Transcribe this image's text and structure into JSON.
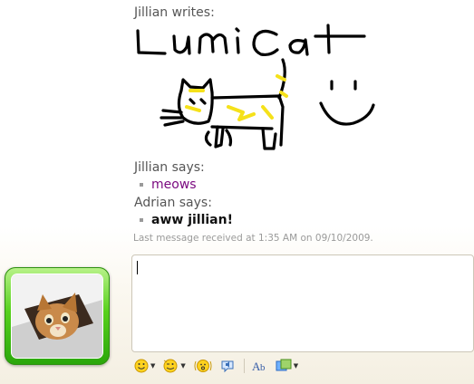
{
  "conversation": {
    "handwriting": {
      "sender": "Jillian writes:",
      "ink_text": "Lumicat"
    },
    "messages": [
      {
        "sender": "Jillian says:",
        "text": "meows",
        "color": "#7b0a80"
      },
      {
        "sender": "Adrian says:",
        "text": "aww jillian!",
        "color": "#111111"
      }
    ],
    "status": "Last message received at 1:35 AM on 09/10/2009."
  },
  "input": {
    "value": ""
  },
  "toolbar": {
    "items": [
      "emoticon-icon",
      "wink-icon",
      "nudge-icon",
      "voice-clip-icon",
      "font-icon",
      "background-icon"
    ]
  },
  "colors": {
    "avatar_frame": "#58d11d",
    "ink_black": "#000000",
    "ink_yellow": "#f5e11a"
  }
}
